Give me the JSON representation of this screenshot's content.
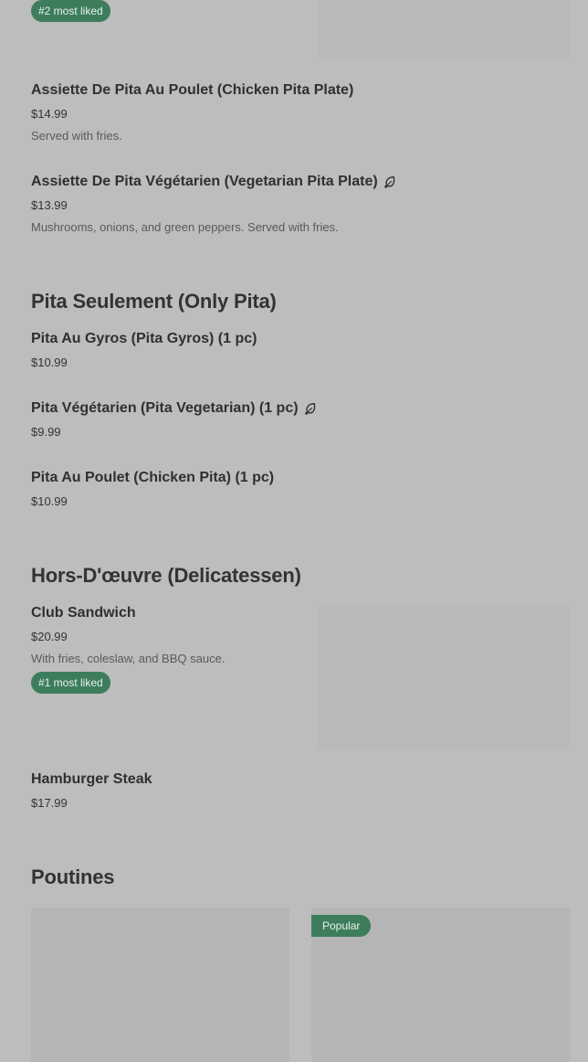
{
  "top": {
    "badge": "#2 most liked"
  },
  "pita_plates": [
    {
      "name": "Assiette De Pita Au Poulet (Chicken Pita Plate)",
      "price": "$14.99",
      "description": "Served with fries."
    },
    {
      "name": "Assiette De Pita Végétarien (Vegetarian Pita Plate)",
      "price": "$13.99",
      "description": "Mushrooms, onions, and green peppers. Served with fries.",
      "icon": "leaf-icon"
    }
  ],
  "pita_only": {
    "title": "Pita Seulement (Only Pita)",
    "items": [
      {
        "name": "Pita Au Gyros (Pita Gyros) (1 pc)",
        "price": "$10.99"
      },
      {
        "name": "Pita Végétarien (Pita Vegetarian) (1 pc)",
        "price": "$9.99",
        "icon": "leaf-icon"
      },
      {
        "name": "Pita Au Poulet (Chicken Pita) (1 pc)",
        "price": "$10.99"
      }
    ]
  },
  "delicatessen": {
    "title": "Hors-D'œuvre (Delicatessen)",
    "items": [
      {
        "name": "Club Sandwich",
        "price": "$20.99",
        "description": "With fries, coleslaw, and BBQ sauce.",
        "badge": "#1 most liked"
      },
      {
        "name": "Hamburger Steak",
        "price": "$17.99"
      }
    ]
  },
  "poutines": {
    "title": "Poutines",
    "cards": [
      {
        "badge": ""
      },
      {
        "badge": "Popular"
      }
    ]
  },
  "colors": {
    "background": "#bdbdbd",
    "badge": "#3e7d5c",
    "image_placeholder": "#b5b5b5"
  }
}
